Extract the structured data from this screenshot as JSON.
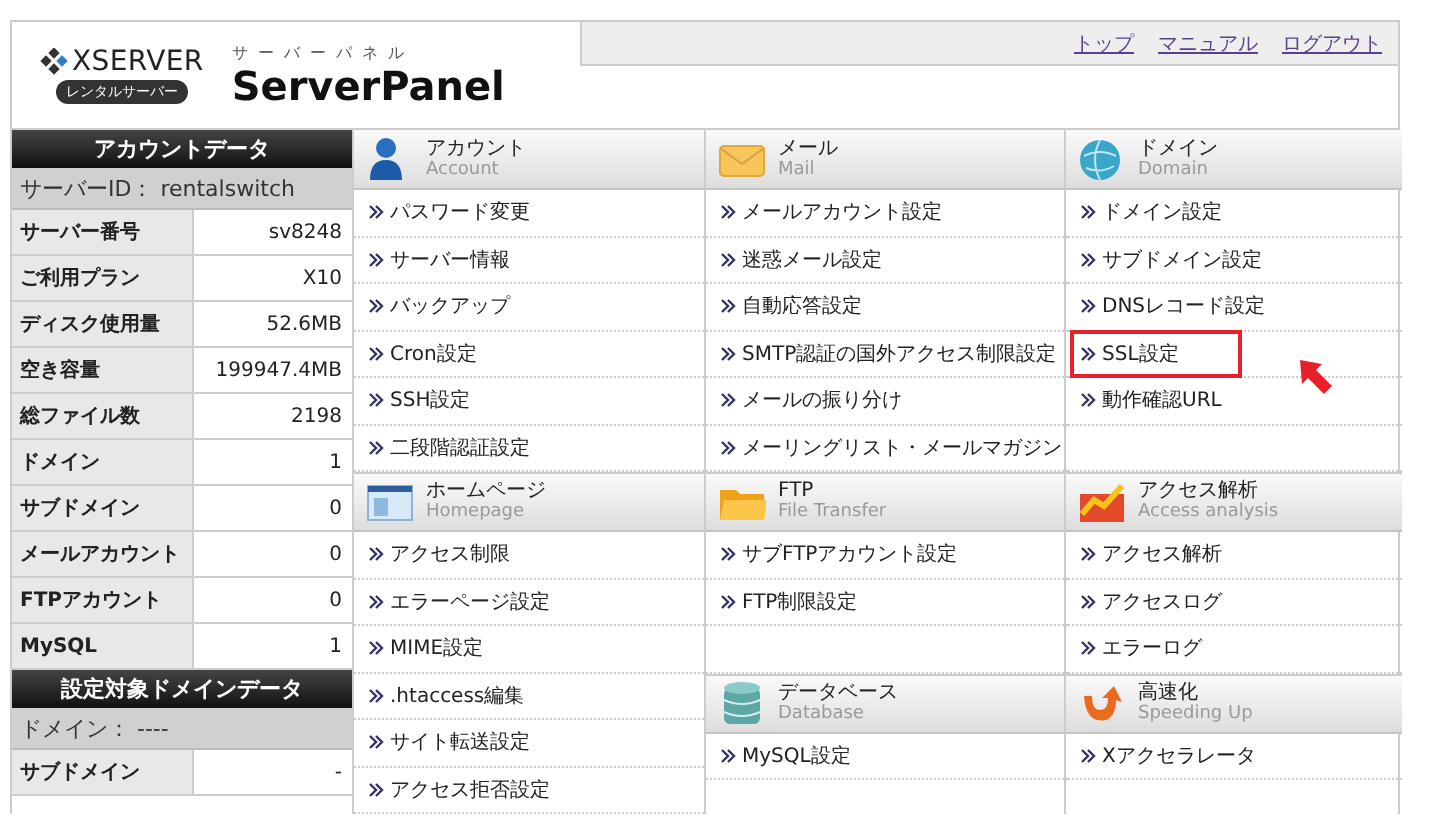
{
  "header": {
    "logo": {
      "brand": "XSERVER",
      "badge": "レンタルサーバー",
      "kana": "サーバーパネル",
      "title": "ServerPanel"
    },
    "nav": [
      {
        "label": "トップ"
      },
      {
        "label": "マニュアル"
      },
      {
        "label": "ログアウト"
      }
    ]
  },
  "sidebar": {
    "sections": [
      {
        "title": "アカウントデータ",
        "subtitle": "サーバーID： rentalswitch",
        "rows": [
          {
            "label": "サーバー番号",
            "value": "sv8248"
          },
          {
            "label": "ご利用プラン",
            "value": "X10"
          },
          {
            "label": "ディスク使用量",
            "value": "52.6MB"
          },
          {
            "label": "空き容量",
            "value": "199947.4MB"
          },
          {
            "label": "総ファイル数",
            "value": "2198"
          },
          {
            "label": "ドメイン",
            "value": "1"
          },
          {
            "label": "サブドメイン",
            "value": "0"
          },
          {
            "label": "メールアカウント",
            "value": "0"
          },
          {
            "label": "FTPアカウント",
            "value": "0"
          },
          {
            "label": "MySQL",
            "value": "1"
          }
        ]
      },
      {
        "title": "設定対象ドメインデータ",
        "subtitle": "ドメイン： ----",
        "rows": [
          {
            "label": "サブドメイン",
            "value": "-"
          }
        ]
      }
    ]
  },
  "menu": {
    "columns": [
      {
        "sections": [
          {
            "kind": "account",
            "title": "アカウント",
            "subtitle": "Account",
            "items": [
              {
                "label": "パスワード変更",
                "highlighted": false
              },
              {
                "label": "サーバー情報",
                "highlighted": false
              },
              {
                "label": "バックアップ",
                "highlighted": false
              },
              {
                "label": "Cron設定",
                "highlighted": false
              },
              {
                "label": "SSH設定",
                "highlighted": false
              },
              {
                "label": "二段階認証設定",
                "highlighted": false
              }
            ]
          },
          {
            "kind": "homepage",
            "title": "ホームページ",
            "subtitle": "Homepage",
            "items": [
              {
                "label": "アクセス制限",
                "highlighted": false
              },
              {
                "label": "エラーページ設定",
                "highlighted": false
              },
              {
                "label": "MIME設定",
                "highlighted": false
              },
              {
                "label": ".htaccess編集",
                "highlighted": false
              },
              {
                "label": "サイト転送設定",
                "highlighted": false
              },
              {
                "label": "アクセス拒否設定",
                "highlighted": false
              }
            ]
          }
        ]
      },
      {
        "sections": [
          {
            "kind": "mail",
            "title": "メール",
            "subtitle": "Mail",
            "items": [
              {
                "label": "メールアカウント設定",
                "highlighted": false
              },
              {
                "label": "迷惑メール設定",
                "highlighted": false
              },
              {
                "label": "自動応答設定",
                "highlighted": false
              },
              {
                "label": "SMTP認証の国外アクセス制限設定",
                "highlighted": false
              },
              {
                "label": "メールの振り分け",
                "highlighted": false
              },
              {
                "label": "メーリングリスト・メールマガジン",
                "highlighted": false
              }
            ]
          },
          {
            "kind": "ftp",
            "title": "FTP",
            "subtitle": "File Transfer",
            "items": [
              {
                "label": "サブFTPアカウント設定",
                "highlighted": false
              },
              {
                "label": "FTP制限設定",
                "highlighted": false
              }
            ]
          },
          {
            "kind": "database",
            "title": "データベース",
            "subtitle": "Database",
            "items": [
              {
                "label": "MySQL設定",
                "highlighted": false
              }
            ]
          }
        ]
      },
      {
        "sections": [
          {
            "kind": "domain",
            "title": "ドメイン",
            "subtitle": "Domain",
            "items": [
              {
                "label": "ドメイン設定",
                "highlighted": false
              },
              {
                "label": "サブドメイン設定",
                "highlighted": false
              },
              {
                "label": "DNSレコード設定",
                "highlighted": false
              },
              {
                "label": "SSL設定",
                "highlighted": true
              },
              {
                "label": "動作確認URL",
                "highlighted": false
              }
            ]
          },
          {
            "kind": "analytics",
            "title": "アクセス解析",
            "subtitle": "Access analysis",
            "items": [
              {
                "label": "アクセス解析",
                "highlighted": false
              },
              {
                "label": "アクセスログ",
                "highlighted": false
              },
              {
                "label": "エラーログ",
                "highlighted": false
              }
            ]
          },
          {
            "kind": "speed",
            "title": "高速化",
            "subtitle": "Speeding Up",
            "items": [
              {
                "label": "Xアクセラレータ",
                "highlighted": false
              }
            ]
          }
        ]
      }
    ]
  }
}
